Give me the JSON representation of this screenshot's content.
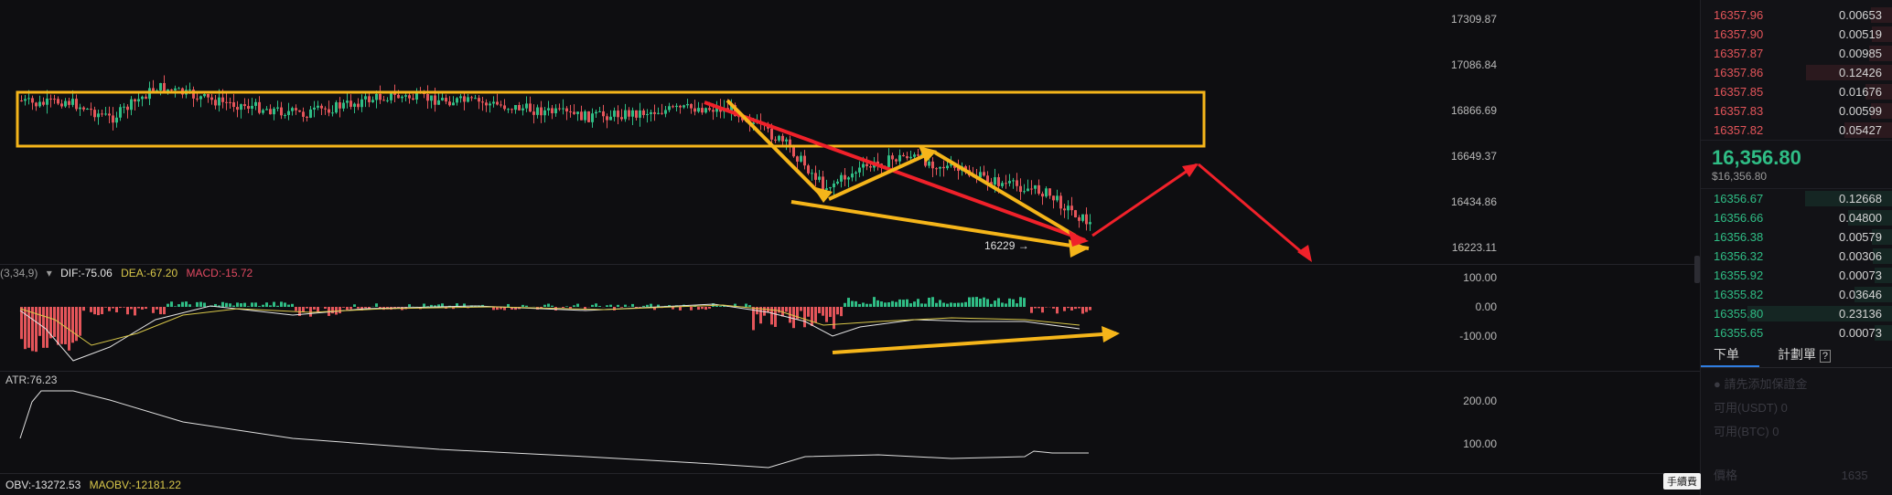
{
  "price_axis": [
    "17309.87",
    "17086.84",
    "16866.69",
    "16649.37",
    "16434.86",
    "16223.11"
  ],
  "macd_axis": [
    "100.00",
    "0.00",
    "-100.00"
  ],
  "atr_axis": [
    "200.00",
    "100.00"
  ],
  "macd_legend": {
    "params": "(3,34,9)",
    "dif": "DIF:-75.06",
    "dea": "DEA:-67.20",
    "macd": "MACD:-15.72"
  },
  "atr_legend": "ATR:76.23",
  "obv_legend": {
    "obv": "OBV:-13272.53",
    "maobv": "MAOBV:-12181.22"
  },
  "low_marker": "16229 →",
  "colors": {
    "up": "#2fbd85",
    "down": "#e4555a",
    "annotation_yellow": "#f5b51a",
    "annotation_red": "#f0212a",
    "dif": "#e6e6e6",
    "dea": "#d9c84a",
    "macd": "#e24a62"
  },
  "asks": [
    {
      "price": "16357.96",
      "qty": "0.00653"
    },
    {
      "price": "16357.90",
      "qty": "0.00519"
    },
    {
      "price": "16357.87",
      "qty": "0.00985"
    },
    {
      "price": "16357.86",
      "qty": "0.12426"
    },
    {
      "price": "16357.85",
      "qty": "0.01676"
    },
    {
      "price": "16357.83",
      "qty": "0.00599"
    },
    {
      "price": "16357.82",
      "qty": "0.05427"
    }
  ],
  "mid_price": "16,356.80",
  "mid_price_usd": "$16,356.80",
  "bids": [
    {
      "price": "16356.67",
      "qty": "0.12668"
    },
    {
      "price": "16356.66",
      "qty": "0.04800"
    },
    {
      "price": "16356.38",
      "qty": "0.00579"
    },
    {
      "price": "16356.32",
      "qty": "0.00306"
    },
    {
      "price": "16355.92",
      "qty": "0.00073"
    },
    {
      "price": "16355.82",
      "qty": "0.03646"
    },
    {
      "price": "16355.80",
      "qty": "0.23136"
    },
    {
      "price": "16355.65",
      "qty": "0.00073"
    }
  ],
  "tabs": {
    "order": "下单",
    "plan": "計劃單"
  },
  "form": {
    "hint": "請先添加保證金",
    "avail_usdt": "可用(USDT) 0",
    "avail_btc": "可用(BTC) 0",
    "price_label": "價格",
    "price_value": "1635"
  },
  "tooltip": "手續費"
}
